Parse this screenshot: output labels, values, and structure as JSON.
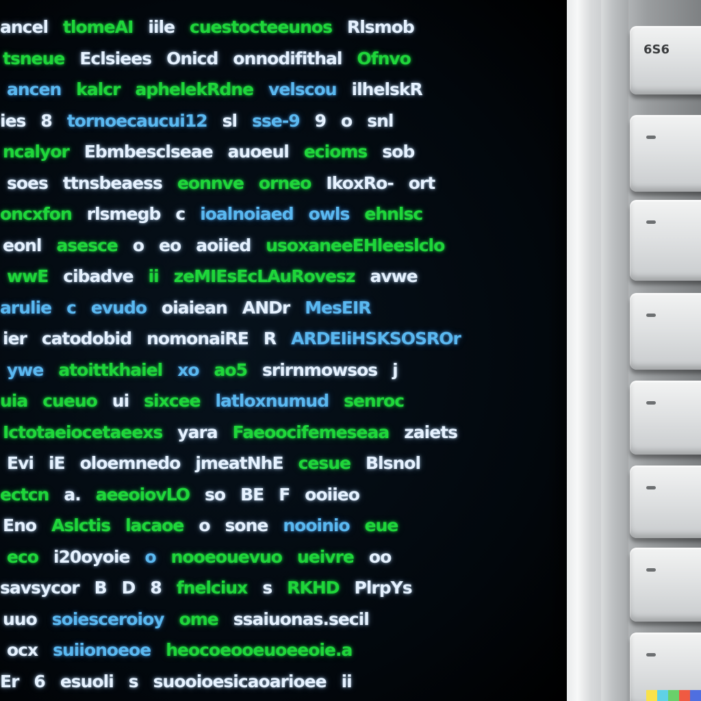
{
  "screen": {
    "lines": [
      [
        [
          "ancel",
          "white"
        ],
        [
          "tlomeAI",
          "green"
        ],
        [
          "iile",
          "white"
        ],
        [
          "cuestocteeunos",
          "green"
        ],
        [
          "Rlsmob",
          "white"
        ]
      ],
      [
        [
          "tsneue",
          "green"
        ],
        [
          "Eclsiees",
          "white"
        ],
        [
          "Onicd",
          "white"
        ],
        [
          "onnodifithal",
          "white"
        ],
        [
          "Ofnvo",
          "green"
        ]
      ],
      [
        [
          "ancen",
          "blue"
        ],
        [
          "kalcr",
          "green"
        ],
        [
          "aphelekRdne",
          "green"
        ],
        [
          "velscou",
          "blue"
        ],
        [
          "ilhelskR",
          "white"
        ]
      ],
      [
        [
          "ies",
          "white"
        ],
        [
          "8",
          "white"
        ],
        [
          "tornoecaucui12",
          "blue"
        ],
        [
          "sl",
          "white"
        ],
        [
          "sse-9",
          "blue"
        ],
        [
          "9",
          "white"
        ],
        [
          "o",
          "white"
        ],
        [
          "snl",
          "white"
        ]
      ],
      [
        [
          "ncalyor",
          "green"
        ],
        [
          "Ebmbesclseae",
          "white"
        ],
        [
          "auoeul",
          "white"
        ],
        [
          "ecioms",
          "green"
        ],
        [
          "sob",
          "white"
        ]
      ],
      [
        [
          "soes",
          "white"
        ],
        [
          "ttnsbeaess",
          "white"
        ],
        [
          "eonnve",
          "green"
        ],
        [
          "orneo",
          "green"
        ],
        [
          "IkoxRo-",
          "white"
        ],
        [
          "ort",
          "white"
        ]
      ],
      [
        [
          "oncxfon",
          "green"
        ],
        [
          "rlsmegb",
          "white"
        ],
        [
          "c",
          "white"
        ],
        [
          "ioalnoiaed",
          "blue"
        ],
        [
          "owls",
          "blue"
        ],
        [
          "ehnlsc",
          "green"
        ]
      ],
      [
        [
          "eonl",
          "white"
        ],
        [
          "asesce",
          "green"
        ],
        [
          "o",
          "white"
        ],
        [
          "eo",
          "white"
        ],
        [
          "aoiied",
          "white"
        ],
        [
          "usoxaneeEHleeslclo",
          "green"
        ]
      ],
      [
        [
          "wwE",
          "green"
        ],
        [
          "cibadve",
          "white"
        ],
        [
          "ii",
          "green"
        ],
        [
          "zeMIEsEcLAuRovesz",
          "green"
        ],
        [
          "avwe",
          "white"
        ]
      ],
      [
        [
          "arulie",
          "blue"
        ],
        [
          "c",
          "blue"
        ],
        [
          "evudo",
          "blue"
        ],
        [
          "oiaiean",
          "white"
        ],
        [
          "ANDr",
          "white"
        ],
        [
          "MesEIR",
          "blue"
        ]
      ],
      [
        [
          "ier",
          "white"
        ],
        [
          "catodobid",
          "white"
        ],
        [
          "nomonaiRE",
          "white"
        ],
        [
          "R",
          "white"
        ],
        [
          "ARDEIiHSKSOSROr",
          "blue"
        ]
      ],
      [
        [
          "ywe",
          "blue"
        ],
        [
          "atoittkhaiel",
          "green"
        ],
        [
          "xo",
          "blue"
        ],
        [
          "ao5",
          "green"
        ],
        [
          "srirnmowsos",
          "white"
        ],
        [
          "j",
          "white"
        ]
      ],
      [
        [
          "uia",
          "green"
        ],
        [
          "cueuo",
          "green"
        ],
        [
          "ui",
          "white"
        ],
        [
          "sixcee",
          "green"
        ],
        [
          "latloxnumud",
          "blue"
        ],
        [
          "senroc",
          "green"
        ]
      ],
      [
        [
          "Ictotaeiocetaeexs",
          "green"
        ],
        [
          "yara",
          "white"
        ],
        [
          "Faeoocifemeseaa",
          "green"
        ],
        [
          "zaiets",
          "white"
        ]
      ],
      [
        [
          "Evi",
          "white"
        ],
        [
          "iE",
          "white"
        ],
        [
          "oloemnedo",
          "white"
        ],
        [
          "jmeatNhE",
          "white"
        ],
        [
          "cesue",
          "green"
        ],
        [
          "Blsnol",
          "white"
        ]
      ],
      [
        [
          "ectcn",
          "green"
        ],
        [
          "a.",
          "white"
        ],
        [
          "aeeoiovLO",
          "green"
        ],
        [
          "so",
          "white"
        ],
        [
          "BE",
          "white"
        ],
        [
          "F",
          "white"
        ],
        [
          "ooiieo",
          "white"
        ]
      ],
      [
        [
          "Eno",
          "white"
        ],
        [
          "Aslctis",
          "green"
        ],
        [
          "lacaoe",
          "green"
        ],
        [
          "o",
          "white"
        ],
        [
          "sone",
          "white"
        ],
        [
          "nooinio",
          "blue"
        ],
        [
          "eue",
          "green"
        ]
      ],
      [
        [
          "eco",
          "green"
        ],
        [
          "i20oyoie",
          "white"
        ],
        [
          "o",
          "blue"
        ],
        [
          "nooeouevuo",
          "green"
        ],
        [
          "ueivre",
          "green"
        ],
        [
          "oo",
          "white"
        ]
      ],
      [
        [
          "savsycor",
          "white"
        ],
        [
          "B",
          "white"
        ],
        [
          "D",
          "white"
        ],
        [
          "8",
          "white"
        ],
        [
          "fnelciux",
          "green"
        ],
        [
          "s",
          "white"
        ],
        [
          "RKHD",
          "green"
        ],
        [
          "PlrpYs",
          "white"
        ]
      ],
      [
        [
          "uuo",
          "white"
        ],
        [
          "soiesceroioy",
          "blue"
        ],
        [
          "ome",
          "green"
        ],
        [
          "ssaiuonas.secil",
          "white"
        ]
      ],
      [
        [
          "ocx",
          "white"
        ],
        [
          "suiionoeoe",
          "blue"
        ],
        [
          "heocoeooeuoeeoie.a",
          "green"
        ]
      ],
      [
        [
          "Er",
          "white"
        ],
        [
          "6",
          "white"
        ],
        [
          "esuoli",
          "white"
        ],
        [
          "s",
          "white"
        ],
        [
          "suooioesicaoarioee",
          "white"
        ],
        [
          "ii",
          "white"
        ]
      ]
    ]
  },
  "keyboard": {
    "keys": [
      {
        "label": "6S6",
        "glyph": false
      },
      {
        "label": "",
        "glyph": true
      },
      {
        "label": "",
        "glyph": true
      },
      {
        "label": "",
        "glyph": true
      },
      {
        "label": "",
        "glyph": true
      },
      {
        "label": "",
        "glyph": true
      },
      {
        "label": "",
        "glyph": true
      },
      {
        "label": "",
        "glyph": true
      }
    ]
  },
  "colors": {
    "green": "#1fd63a",
    "blue": "#5ab8f0",
    "white": "#e6f2ff",
    "strip": [
      "#f9e24a",
      "#5fd1e6",
      "#6ad06a",
      "#ef5a42",
      "#4f6fe0"
    ]
  }
}
